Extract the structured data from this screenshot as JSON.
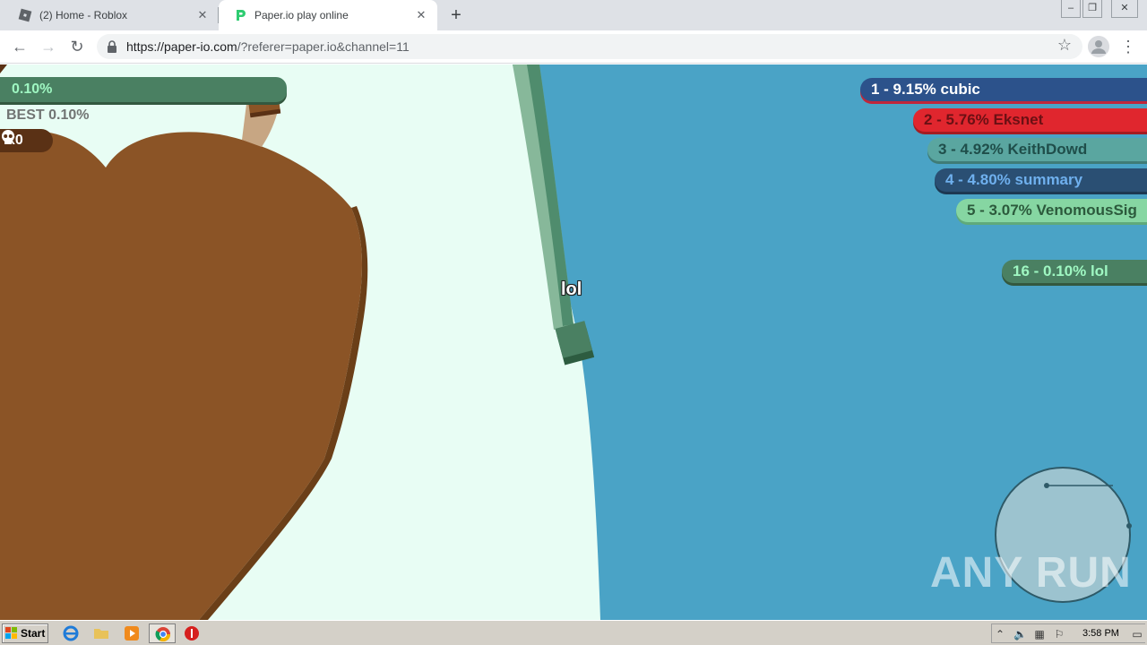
{
  "browser": {
    "tabs": [
      {
        "title": "(2) Home - Roblox",
        "icon": "roblox-icon",
        "active": false
      },
      {
        "title": "Paper.io play online",
        "icon": "paperio-icon",
        "active": true
      }
    ],
    "new_tab": "+",
    "url_host": "https://paper-io.com",
    "url_rest": "/?referer=paper.io&channel=11"
  },
  "game": {
    "my_score": "0.10%",
    "best": "BEST 0.10%",
    "kills": "x0",
    "player_name": "lol",
    "leaderboard": [
      {
        "label": "1 - 9.15% cubic",
        "bg": "#2c528b",
        "fg": "#ffffff",
        "shadow": "#c0263a"
      },
      {
        "label": "2 - 5.76% Eksnet",
        "bg": "#e0262e",
        "fg": "#6b1014",
        "shadow": "#a51c22"
      },
      {
        "label": "3 - 4.92% KeithDowd",
        "bg": "#5aa6a0",
        "fg": "#1f4e4a",
        "shadow": "#3f7c77"
      },
      {
        "label": "4 - 4.80% summary",
        "bg": "#2a4f73",
        "fg": "#6fb0ee",
        "shadow": "#1d3852"
      },
      {
        "label": "5 - 3.07% VenomousSig",
        "bg": "#86d6a2",
        "fg": "#2c5a3c",
        "shadow": "#5faa7b"
      },
      {
        "label": "16 - 0.10% lol",
        "bg": "#4a8062",
        "fg": "#9ff7c2",
        "shadow": "#33583f"
      }
    ],
    "colors": {
      "own_territory": "#e8fdf4",
      "enemy_territory": "#4aa3c6",
      "brown_territory": "#8b5426"
    }
  },
  "watermark": "ANY RUN",
  "taskbar": {
    "start": "Start",
    "clock": "3:58 PM"
  }
}
